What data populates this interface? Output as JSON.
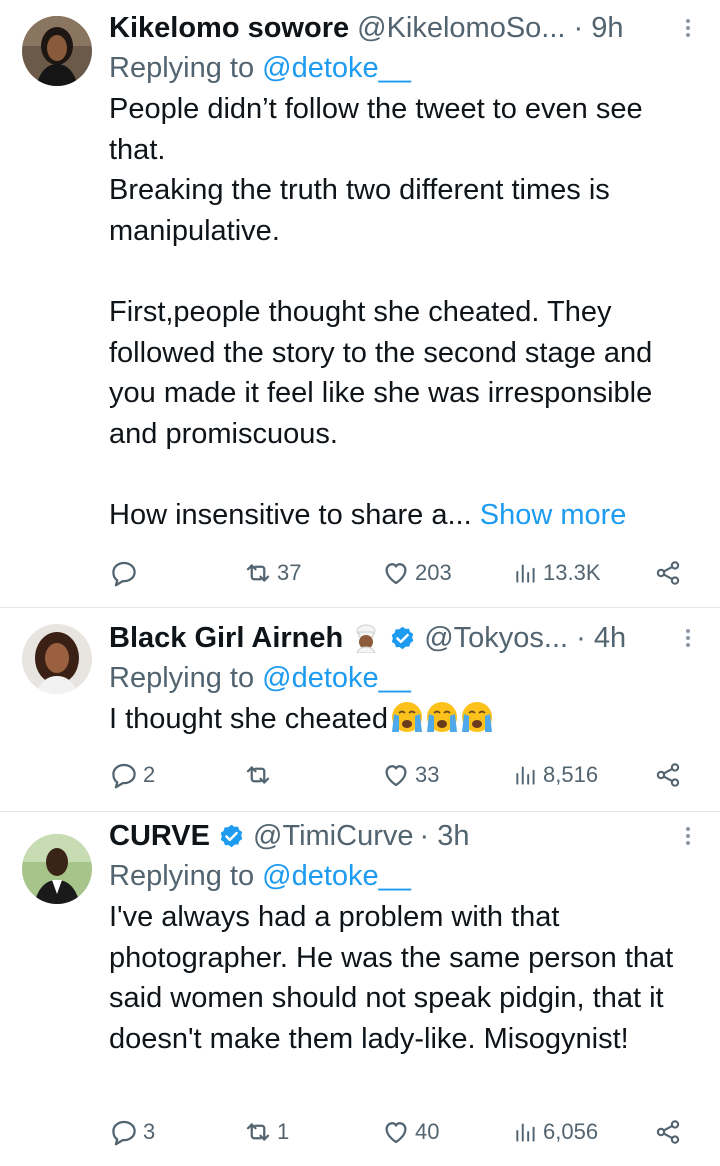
{
  "tweets": [
    {
      "display_name": "Kikelomo sowore",
      "handle": "@KikelomoSo...",
      "time": "· 9h",
      "replying_prefix": "Replying to ",
      "replying_to": "@detoke__",
      "body": [
        "People didn’t follow the tweet to even see that.",
        "Breaking the truth two different times is manipulative.",
        "",
        "First,people thought she cheated. They followed the story to the second stage and you made it feel like she was irresponsible and promiscuous.",
        ""
      ],
      "body_last": "How insensitive to share a... ",
      "show_more": "Show more",
      "replies": "",
      "retweets": "37",
      "likes": "203",
      "views": "13.3K"
    },
    {
      "display_name": "Black Girl Airneh",
      "name_emoji": "cook-emoji",
      "verified": true,
      "handle": "@Tokyos...",
      "time": "· 4h",
      "replying_prefix": "Replying to ",
      "replying_to": "@detoke__",
      "body_text": "I thought she cheated",
      "body_emoji": "loudly-crying-face-emoji x3",
      "replies": "2",
      "retweets": "",
      "likes": "33",
      "views": "8,516"
    },
    {
      "display_name": "CURVE",
      "verified": true,
      "handle": "@TimiCurve",
      "time": "· 3h",
      "replying_prefix": "Replying to ",
      "replying_to": "@detoke__",
      "body_text": "I've always had a problem with that photographer. He was the same person that said women should not speak pidgin, that it doesn't make them lady-like. Misogynist!",
      "replies": "3",
      "retweets": "1",
      "likes": "40",
      "views": "6,056"
    }
  ],
  "colors": {
    "text": "#0f1419",
    "secondary": "#536471",
    "link": "#1d9bf0",
    "verified": "#1d9bf0",
    "divider": "#e6e9ec"
  },
  "icons": {
    "reply": "reply-icon",
    "retweet": "retweet-icon",
    "like": "heart-icon",
    "views": "views-icon",
    "share": "share-icon",
    "more": "more-options-icon",
    "verified": "verified-badge-icon"
  }
}
